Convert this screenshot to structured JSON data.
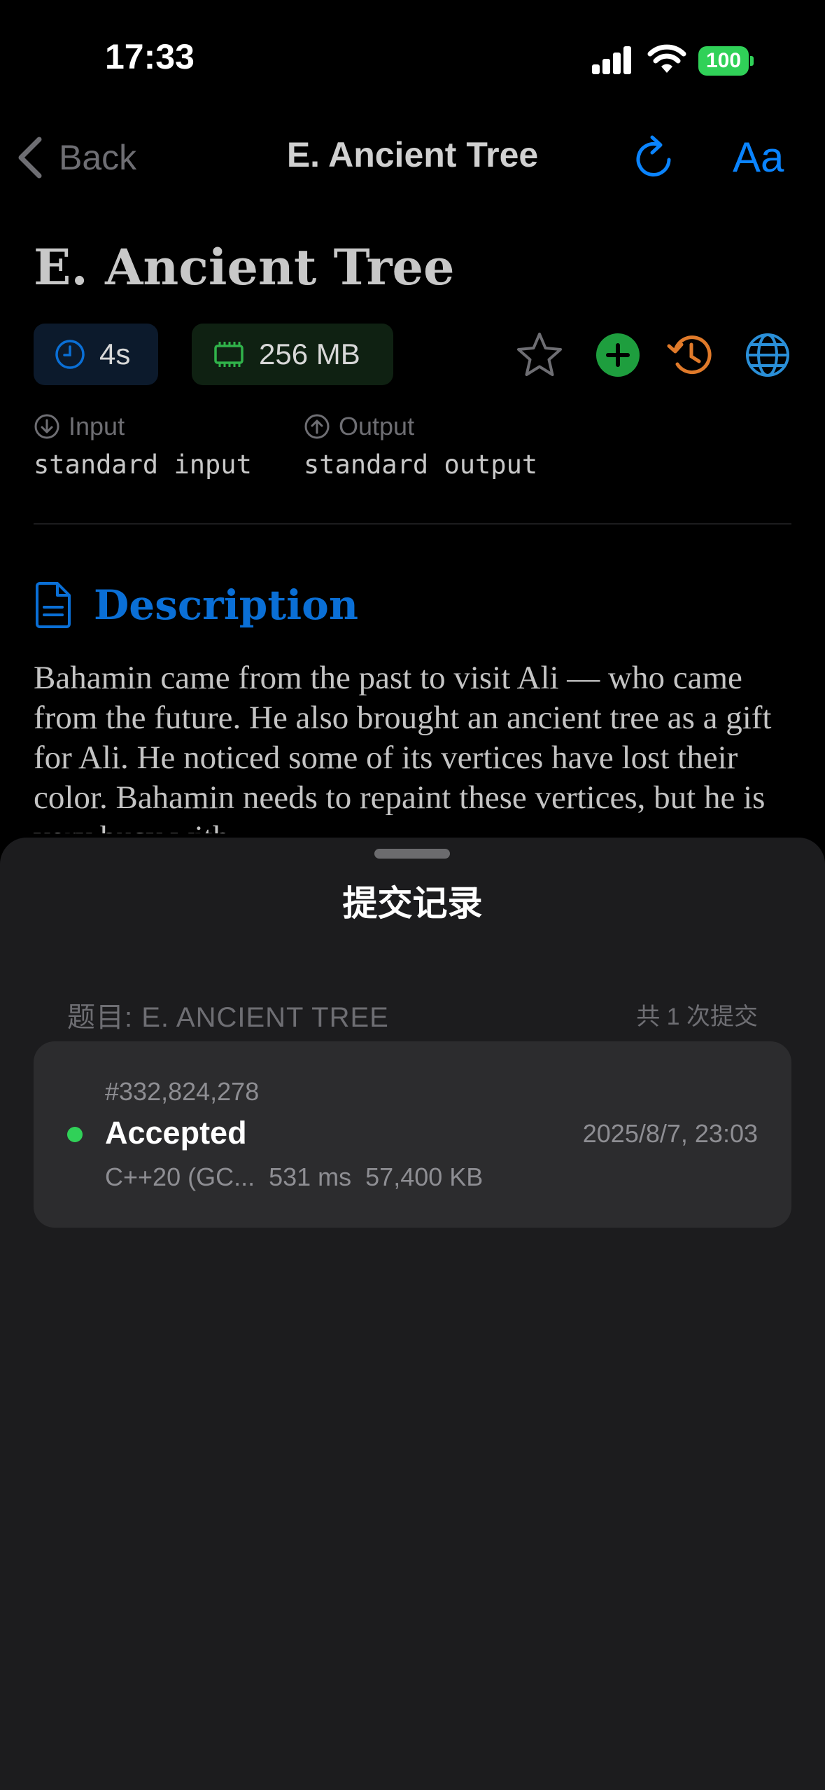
{
  "status_bar": {
    "time": "17:33",
    "battery": "100"
  },
  "nav": {
    "back_label": "Back",
    "title": "E. Ancient Tree",
    "font_button": "Aa"
  },
  "problem": {
    "title": "E. Ancient Tree",
    "time_limit": "4s",
    "memory_limit": "256 MB",
    "input_label": "Input",
    "input_value": "standard input",
    "output_label": "Output",
    "output_value": "standard output"
  },
  "description": {
    "heading": "Description",
    "text": "Bahamin came from the past to visit Ali — who came from the future. He also brought an ancient tree as a gift for Ali. He noticed some of its vertices have lost their color. Bahamin needs to repaint these vertices, but he is very busy with"
  },
  "sheet": {
    "title": "提交记录",
    "section_label": "题目: E. ANCIENT TREE",
    "count_label": "共 1 次提交",
    "submissions": [
      {
        "id": "#332,824,278",
        "verdict": "Accepted",
        "date": "2025/8/7, 23:03",
        "language": "C++20 (GC...",
        "time": "531 ms",
        "memory": "57,400 KB"
      }
    ]
  },
  "colors": {
    "accent": "#0a84ff",
    "accepted": "#30d158",
    "history_orange": "#e07a2a"
  }
}
